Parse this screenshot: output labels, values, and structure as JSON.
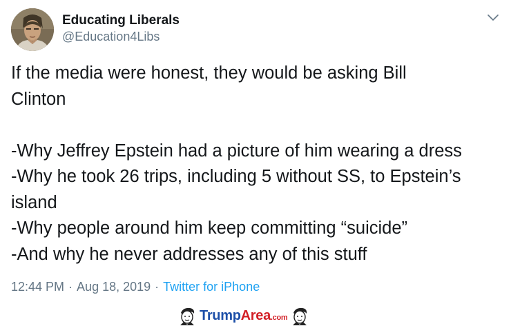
{
  "user": {
    "name": "Educating Liberals",
    "handle": "@Education4Libs"
  },
  "icons": {
    "caret": "chevron-down-icon",
    "avatar": "profile-photo"
  },
  "tweet": {
    "lines": [
      "If the media were honest, they would be asking Bill",
      "Clinton",
      "",
      "-Why Jeffrey Epstein had a picture of him wearing a dress",
      "-Why he took 26 trips, including 5 without SS, to Epstein’s",
      "island",
      "-Why people around him keep committing “suicide”",
      "-And why he never addresses any of this stuff"
    ]
  },
  "meta": {
    "time": "12:44 PM",
    "separator": "·",
    "date": "Aug 18, 2019",
    "source": "Twitter for iPhone"
  },
  "watermark": {
    "trump": "Trump",
    "area": "Area",
    "com": ".com"
  },
  "colors": {
    "text": "#14171a",
    "secondary": "#657786",
    "link": "#1da1f2",
    "watermark_blue": "#1d4fa8",
    "watermark_red": "#d21f26"
  }
}
